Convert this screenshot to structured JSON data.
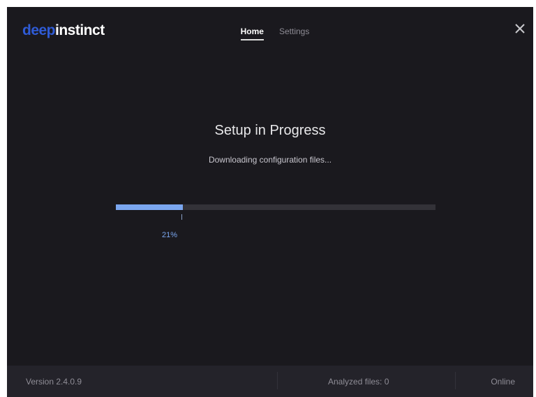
{
  "header": {
    "logo_part1": "deep",
    "logo_part2": "instinct",
    "tabs": [
      {
        "label": "Home",
        "active": true
      },
      {
        "label": "Settings",
        "active": false
      }
    ],
    "close_icon": "close-icon"
  },
  "main": {
    "title": "Setup in Progress",
    "subtitle": "Downloading configuration files...",
    "progress": {
      "percent_value": 21,
      "label": "21%",
      "fill_color": "#7aa6ef"
    }
  },
  "footer": {
    "version": "Version 2.4.0.9",
    "analyzed": "Analyzed files: 0",
    "status": "Online"
  },
  "colors": {
    "background": "#1a191e",
    "brand": "#2f5bd6",
    "accent": "#7aa6ef"
  }
}
